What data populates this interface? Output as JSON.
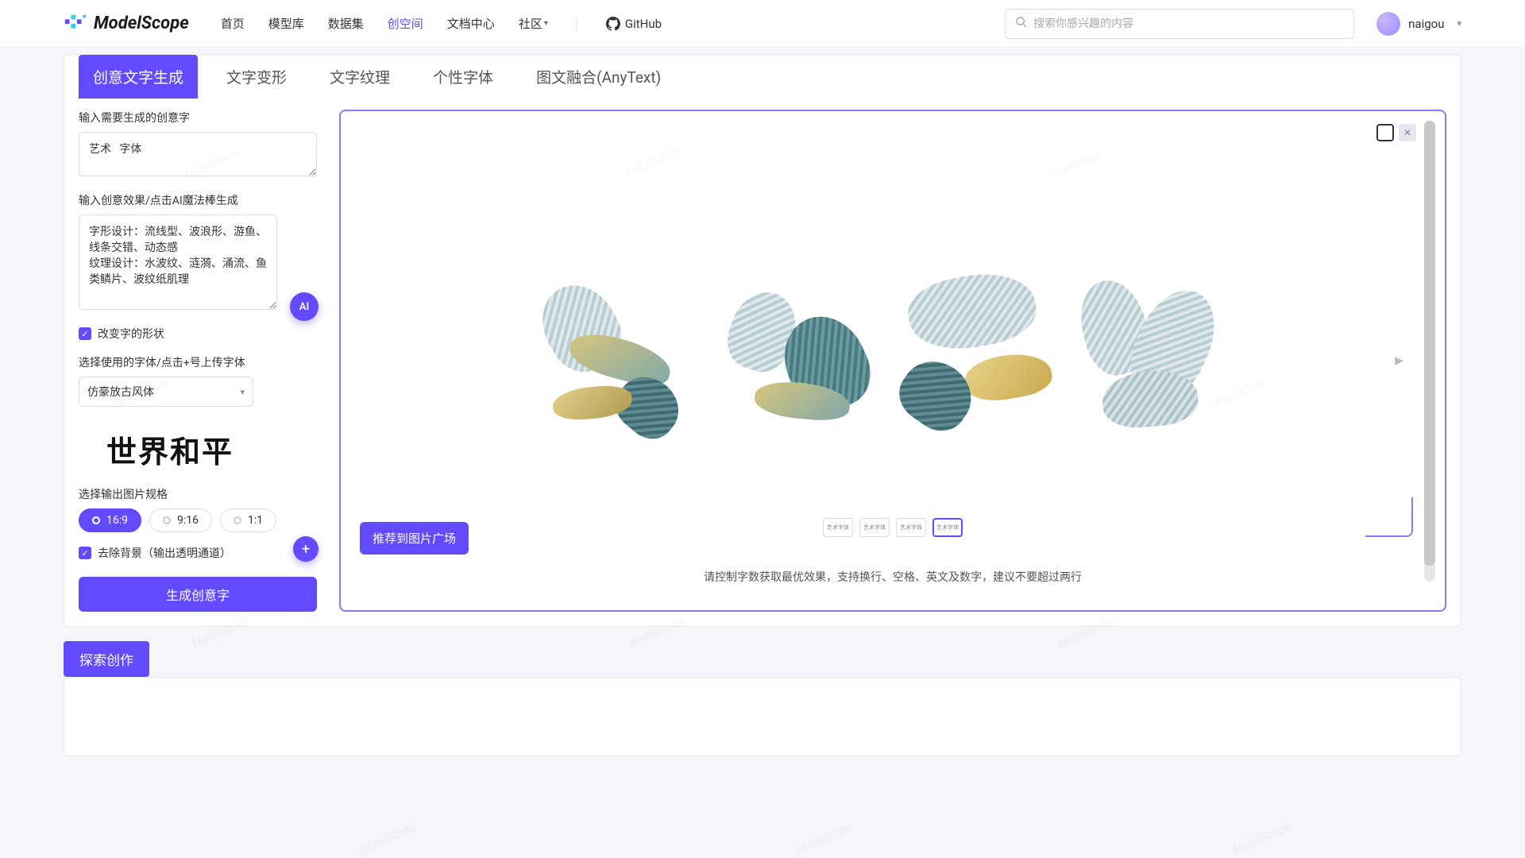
{
  "header": {
    "logo_text": "ModelScope",
    "nav": [
      "首页",
      "模型库",
      "数据集",
      "创空间",
      "文档中心",
      "社区"
    ],
    "nav_active_index": 3,
    "github": "GitHub",
    "search_placeholder": "搜索你感兴趣的内容",
    "username": "naigou"
  },
  "tabs": [
    "创意文字生成",
    "文字变形",
    "文字纹理",
    "个性字体",
    "图文融合(AnyText)"
  ],
  "tabs_active_index": 0,
  "left": {
    "label_input_text": "输入需要生成的创意字",
    "input_text_value": "艺术   字体",
    "label_effect": "输入创意效果/点击AI魔法棒生成",
    "effect_value": "字形设计：流线型、波浪形、游鱼、线条交错、动态感\n纹理设计：水波纹、涟漪、涌流、鱼类鳞片、波纹纸肌理",
    "ai_label": "AI",
    "checkbox_shape": "改变字的形状",
    "label_font": "选择使用的字体/点击+号上传字体",
    "font_value": "仿豪放古风体",
    "plus_label": "+",
    "font_preview_text": "世界和平",
    "label_ratio": "选择输出图片规格",
    "ratios": [
      "16:9",
      "9:16",
      "1:1"
    ],
    "ratio_active_index": 0,
    "checkbox_bg": "去除背景（输出透明通道）",
    "submit": "生成创意字"
  },
  "right": {
    "thumb_label": "艺术字体",
    "recommend": "推荐到图片广场",
    "hint": "请控制字数获取最优效果，支持换行、空格、英文及数字，建议不要超过两行"
  },
  "explore": "探索创作",
  "watermark_text": "ModelScope"
}
